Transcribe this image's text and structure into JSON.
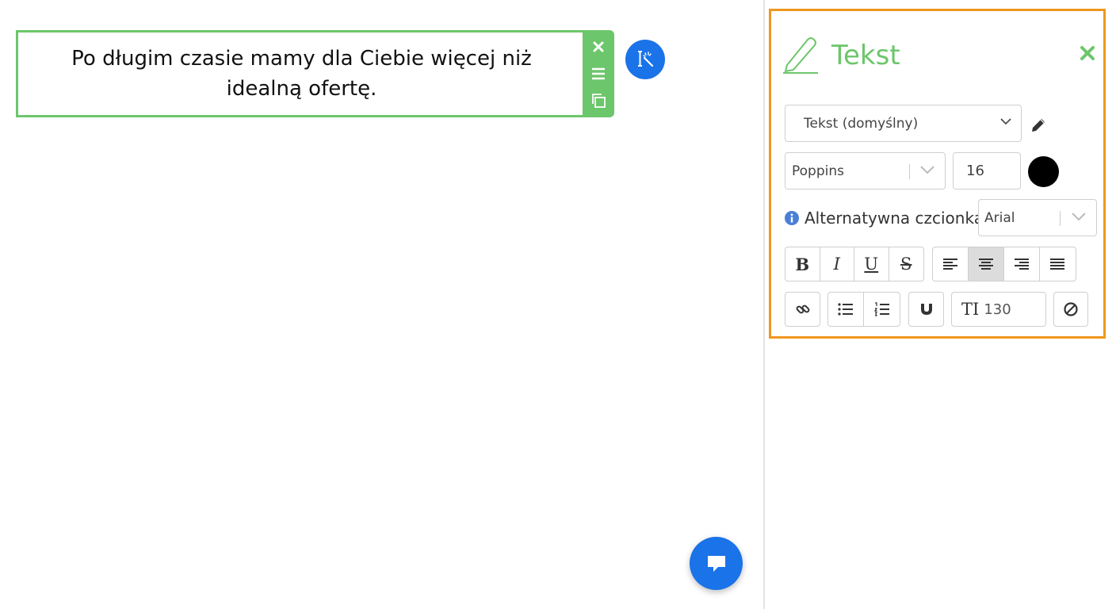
{
  "canvas": {
    "text_block": {
      "content": "Po długim czasie mamy dla Ciebie więcej niż idealną ofertę."
    }
  },
  "panel": {
    "title": "Tekst",
    "style_select": {
      "value": "Tekst (domyślny)"
    },
    "font_select": {
      "value": "Poppins"
    },
    "font_size": "16",
    "text_color": "#000000",
    "alt_font_label": "Alternatywna czcionka:",
    "alt_font_select": {
      "value": "Arial"
    },
    "format_buttons": {
      "bold": "B",
      "italic": "I",
      "underline": "U",
      "strike": "S"
    },
    "line_height": {
      "icon": "TI",
      "value": "130"
    },
    "active_alignment": "center"
  },
  "colors": {
    "accent_green": "#6cc66b",
    "panel_border": "#f0961e",
    "primary_blue": "#1a73e8"
  }
}
